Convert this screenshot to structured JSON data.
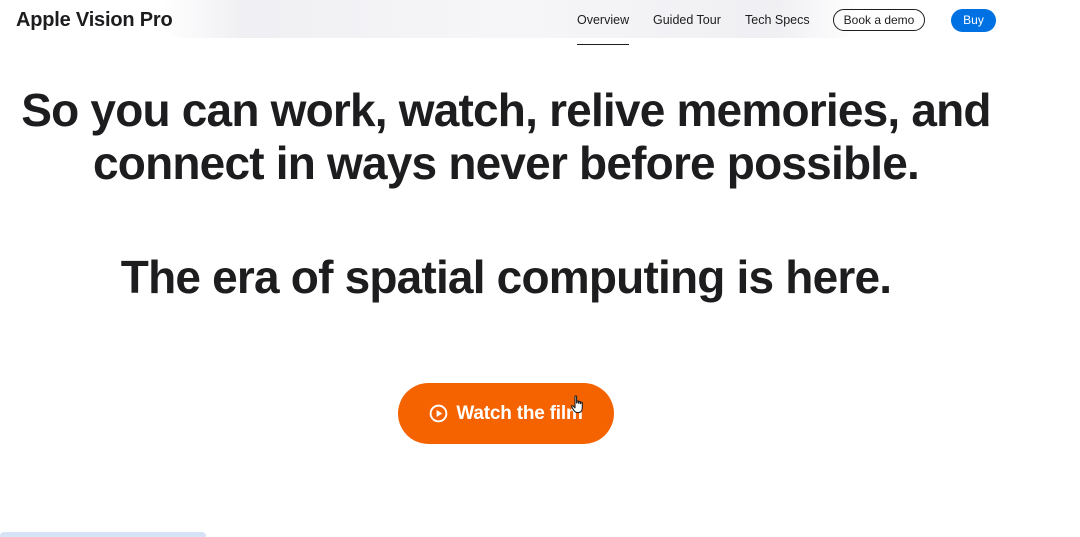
{
  "nav": {
    "brand": "Apple Vision Pro",
    "links": [
      "Overview",
      "Guided Tour",
      "Tech Specs"
    ],
    "active_link": "Overview",
    "book_demo_label": "Book a demo",
    "buy_label": "Buy"
  },
  "hero": {
    "headline_line1": "So you can work, watch, relive memories, and",
    "headline_line2": "connect in ways never before possible.",
    "subheadline": "The era of spatial computing is here.",
    "cta_label": "Watch the film",
    "cta_icon": "play-circle-icon"
  },
  "colors": {
    "text": "#1d1d1f",
    "buy_button": "#0071e3",
    "cta_button": "#f56300"
  }
}
